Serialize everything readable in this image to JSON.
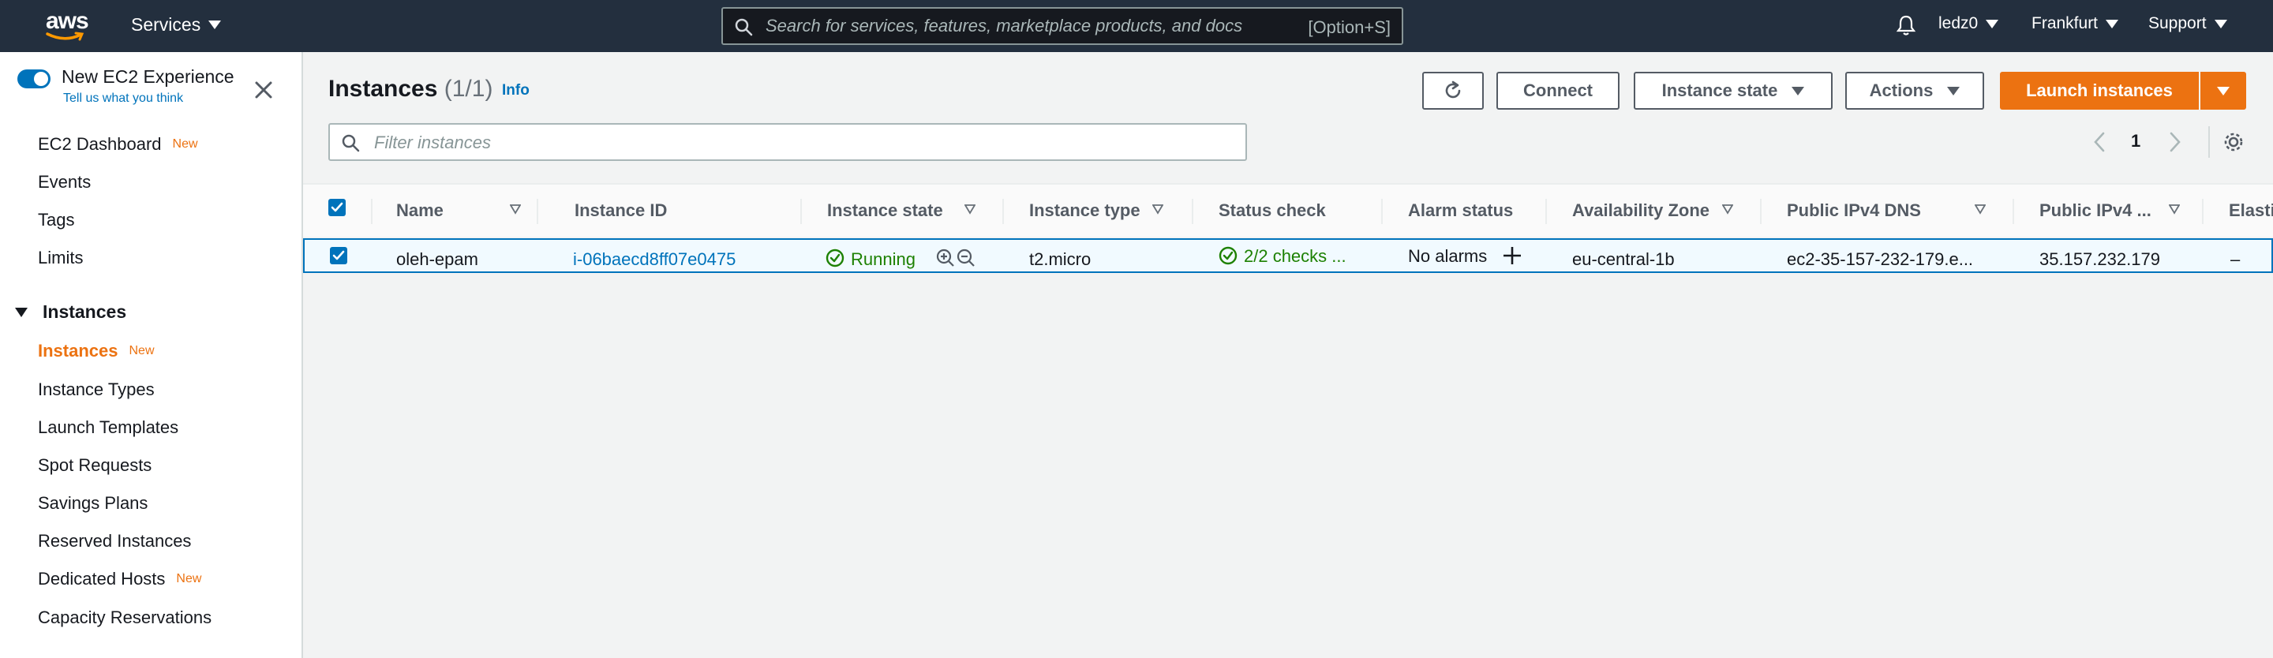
{
  "topnav": {
    "logo_text": "aws",
    "services_label": "Services",
    "search_placeholder": "Search for services, features, marketplace products, and docs",
    "search_shortcut": "[Option+S]",
    "user_label": "ledz0",
    "region_label": "Frankfurt",
    "support_label": "Support"
  },
  "sidebar": {
    "new_experience_label": "New EC2 Experience",
    "tell_us_link": "Tell us what you think",
    "top_items": [
      {
        "label": "EC2 Dashboard",
        "badge": "New"
      },
      {
        "label": "Events",
        "badge": ""
      },
      {
        "label": "Tags",
        "badge": ""
      },
      {
        "label": "Limits",
        "badge": ""
      }
    ],
    "group_label": "Instances",
    "group_items": [
      {
        "label": "Instances",
        "badge": "New"
      },
      {
        "label": "Instance Types",
        "badge": ""
      },
      {
        "label": "Launch Templates",
        "badge": ""
      },
      {
        "label": "Spot Requests",
        "badge": ""
      },
      {
        "label": "Savings Plans",
        "badge": ""
      },
      {
        "label": "Reserved Instances",
        "badge": ""
      },
      {
        "label": "Dedicated Hosts",
        "badge": "New"
      },
      {
        "label": "Capacity Reservations",
        "badge": ""
      }
    ]
  },
  "main": {
    "title": "Instances",
    "count": "(1/1)",
    "info_link": "Info",
    "connect_label": "Connect",
    "instance_state_label": "Instance state",
    "actions_label": "Actions",
    "launch_label": "Launch instances",
    "filter_placeholder": "Filter instances",
    "page_number": "1"
  },
  "table": {
    "headers": [
      "Name",
      "Instance ID",
      "Instance state",
      "Instance type",
      "Status check",
      "Alarm status",
      "Availability Zone",
      "Public IPv4 DNS",
      "Public IPv4 ...",
      "Elasti"
    ],
    "row": {
      "name": "oleh-epam",
      "instance_id": "i-06baecd8ff07e0475",
      "state": "Running",
      "type": "t2.micro",
      "status_check": "2/2 checks ...",
      "alarm_status": "No alarms",
      "az": "eu-central-1b",
      "dns": "ec2-35-157-232-179.e...",
      "ipv4": "35.157.232.179",
      "elastic": "–"
    }
  },
  "colors": {
    "nav_bg": "#232f3e",
    "accent_orange": "#ec7211",
    "link_blue": "#0073bb",
    "ok_green": "#1d8102"
  },
  "icons": [
    "aws-logo",
    "caret-down-icon",
    "search-icon",
    "bell-icon",
    "close-icon",
    "refresh-icon",
    "chevron-left-icon",
    "chevron-right-icon",
    "gear-icon",
    "sort-icon",
    "check-circle-icon",
    "zoom-in-icon",
    "zoom-out-icon",
    "plus-icon",
    "checkbox-icon"
  ]
}
